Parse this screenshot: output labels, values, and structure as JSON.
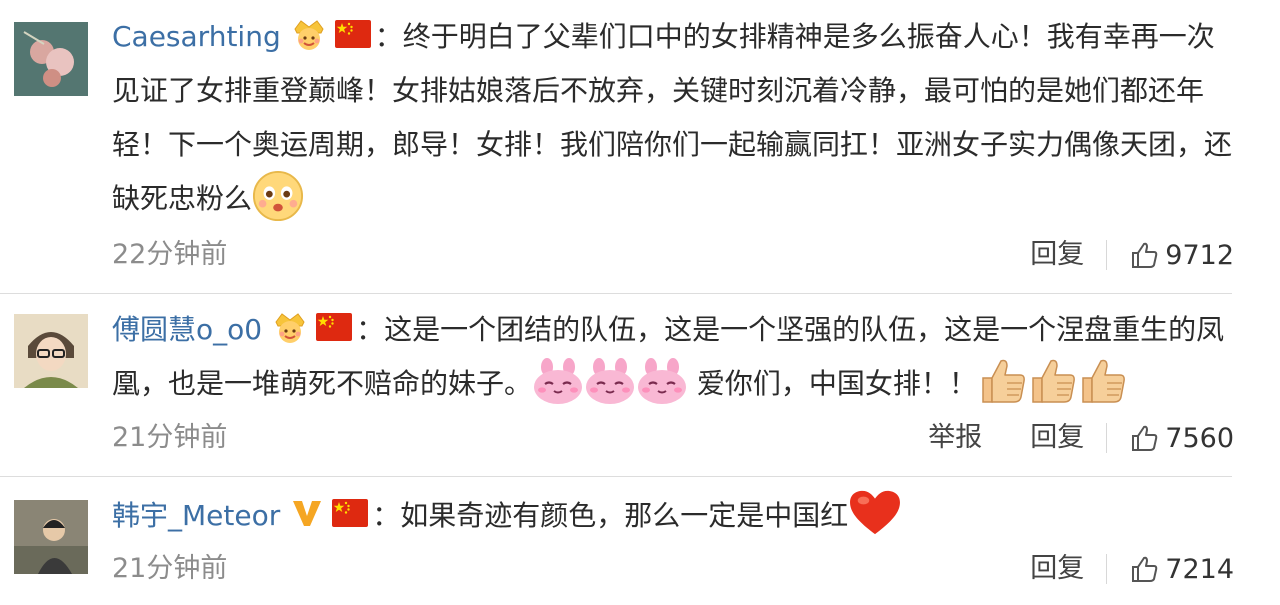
{
  "comments": [
    {
      "username": "Caesarhting",
      "text": "：终于明白了父辈们口中的女排精神是多么振奋人心！我有幸再一次见证了女排重登巅峰！女排姑娘落后不放弃，关键时刻沉着冷静，最可怕的是她们都还年轻！下一个奥运周期，郎导！女排！我们陪你们一起输赢同扛！亚洲女子实力偶像天团，还缺死忠粉么",
      "time": "22分钟前",
      "reply": "回复",
      "likes": "9712",
      "badges": [
        "crown-badge-icon",
        "china-flag-icon"
      ],
      "emoji": [
        "blushing-face-emoji"
      ]
    },
    {
      "username": "傅圆慧o_o0",
      "text": "：这是一个团结的队伍，这是一个坚强的队伍，这是一个涅盘重生的凤凰，也是一堆萌死不赔命的妹子。",
      "text2": "爱你们，中国女排！！",
      "time": "21分钟前",
      "report": "举报",
      "reply": "回复",
      "likes": "7560",
      "badges": [
        "crown-badge-icon",
        "china-flag-icon"
      ],
      "emoji": [
        "pink-bunny-emoji",
        "pink-bunny-emoji",
        "pink-bunny-emoji",
        "thumbs-up-emoji",
        "thumbs-up-emoji",
        "thumbs-up-emoji"
      ]
    },
    {
      "username": "韩宇_Meteor",
      "text": "：如果奇迹有颜色，那么一定是中国红",
      "time": "21分钟前",
      "reply": "回复",
      "likes": "7214",
      "badges": [
        "verified-v-icon",
        "china-flag-icon"
      ],
      "emoji": [
        "red-heart-emoji"
      ]
    }
  ],
  "colors": {
    "username": "#3c6fa5",
    "text": "#2b2b2b",
    "meta": "#8c8c8c",
    "divider": "#dddddd",
    "flag_red": "#de2910",
    "flag_yellow": "#ffde00",
    "vip_orange": "#f5a623"
  }
}
